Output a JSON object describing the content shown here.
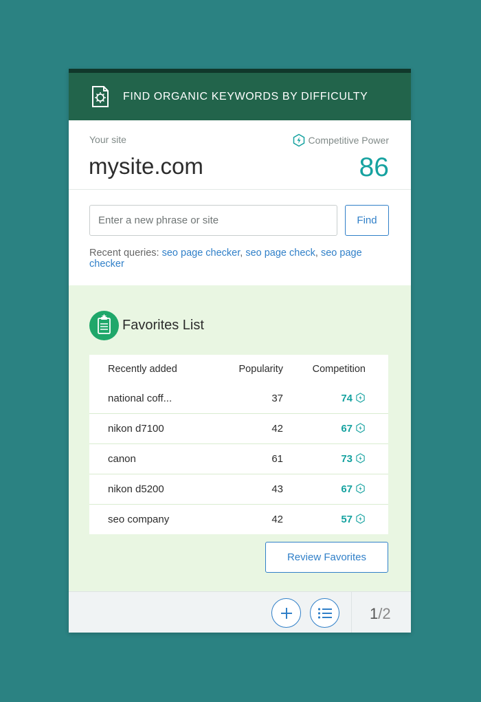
{
  "header": {
    "title": "FIND ORGANIC KEYWORDS BY DIFFICULTY",
    "icon": "document-scan-icon"
  },
  "site": {
    "label": "Your site",
    "name": "mysite.com",
    "power_label": "Competitive Power",
    "power_value": "86"
  },
  "search": {
    "placeholder": "Enter a new phrase or site",
    "value": "",
    "button_label": "Find",
    "recent_prefix": "Recent queries:",
    "recent": [
      "seo page checker",
      "seo page check",
      "seo page checker"
    ]
  },
  "favorites": {
    "title": "Favorites List",
    "columns": [
      "Recently added",
      "Popularity",
      "Competition"
    ],
    "rows": [
      {
        "keyword": "national coff...",
        "popularity": "37",
        "competition": "74"
      },
      {
        "keyword": "nikon d7100",
        "popularity": "42",
        "competition": "67"
      },
      {
        "keyword": "canon",
        "popularity": "61",
        "competition": "73"
      },
      {
        "keyword": "nikon d5200",
        "popularity": "43",
        "competition": "67"
      },
      {
        "keyword": "seo company",
        "popularity": "42",
        "competition": "57"
      }
    ],
    "review_button": "Review Favorites"
  },
  "footer": {
    "page_current": "1",
    "page_total": "2"
  },
  "colors": {
    "header": "#22644b",
    "accent": "#16a2a0",
    "link": "#2f7fc8",
    "favorites_bg": "#e9f6e2",
    "background": "#2b8282"
  }
}
